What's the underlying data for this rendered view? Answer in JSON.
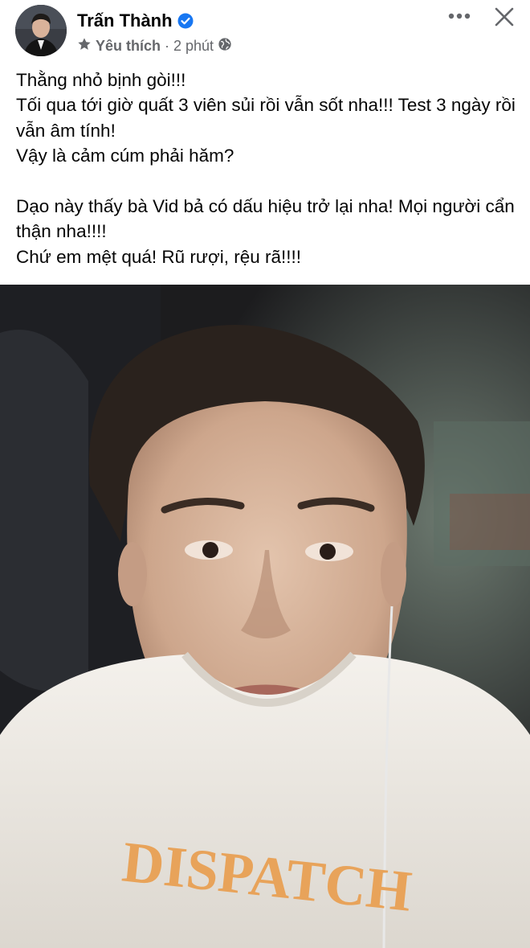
{
  "post": {
    "author": "Trấn Thành",
    "favorite_label": "Yêu thích",
    "separator": "·",
    "time": "2 phút",
    "text_block_1": "Thằng nhỏ bịnh gòi!!!\nTối qua tới giờ quất 3 viên sủi rồi vẫn sốt nha!!! Test 3 ngày rồi vẫn âm tính!\nVậy là cảm cúm phải hăm?",
    "text_block_2": "Dạo này thấy bà Vid bả có dấu hiệu trở lại nha! Mọi người cẩn thận nha!!!!\nChứ em mệt quá! Rũ rượi, rệu rã!!!!",
    "shirt_print": "DISPATCH"
  },
  "icons": {
    "verified": "verified-badge-icon",
    "favorite": "star-icon",
    "audience": "globe-icon",
    "more": "more-options-icon",
    "close": "close-icon"
  },
  "colors": {
    "verified": "#1877f2",
    "meta_text": "#65676b",
    "text": "#050505"
  }
}
